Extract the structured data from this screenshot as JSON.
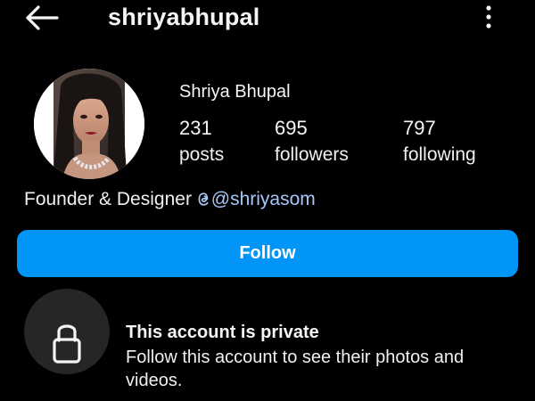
{
  "header": {
    "username": "shriyabhupal",
    "back_icon": "arrow-left-icon",
    "more_icon": "more-vertical-icon"
  },
  "profile": {
    "display_name": "Shriya Bhupal",
    "avatar": "profile-photo",
    "stats": [
      {
        "value": "231",
        "label": "posts"
      },
      {
        "value": "695",
        "label": "followers"
      },
      {
        "value": "797",
        "label": "following"
      }
    ],
    "bio": {
      "text": "Founder & Designer ",
      "mention": "@shriyasom",
      "mention_icon": "threads-icon"
    }
  },
  "actions": {
    "follow_label": "Follow",
    "follow_color": "#0095f6"
  },
  "private_notice": {
    "icon": "lock-icon",
    "title": "This account is private",
    "description": "Follow this account to see their photos and videos."
  },
  "colors": {
    "background": "#000000",
    "mention": "#a8c7fa",
    "lock_circle": "#262626"
  }
}
